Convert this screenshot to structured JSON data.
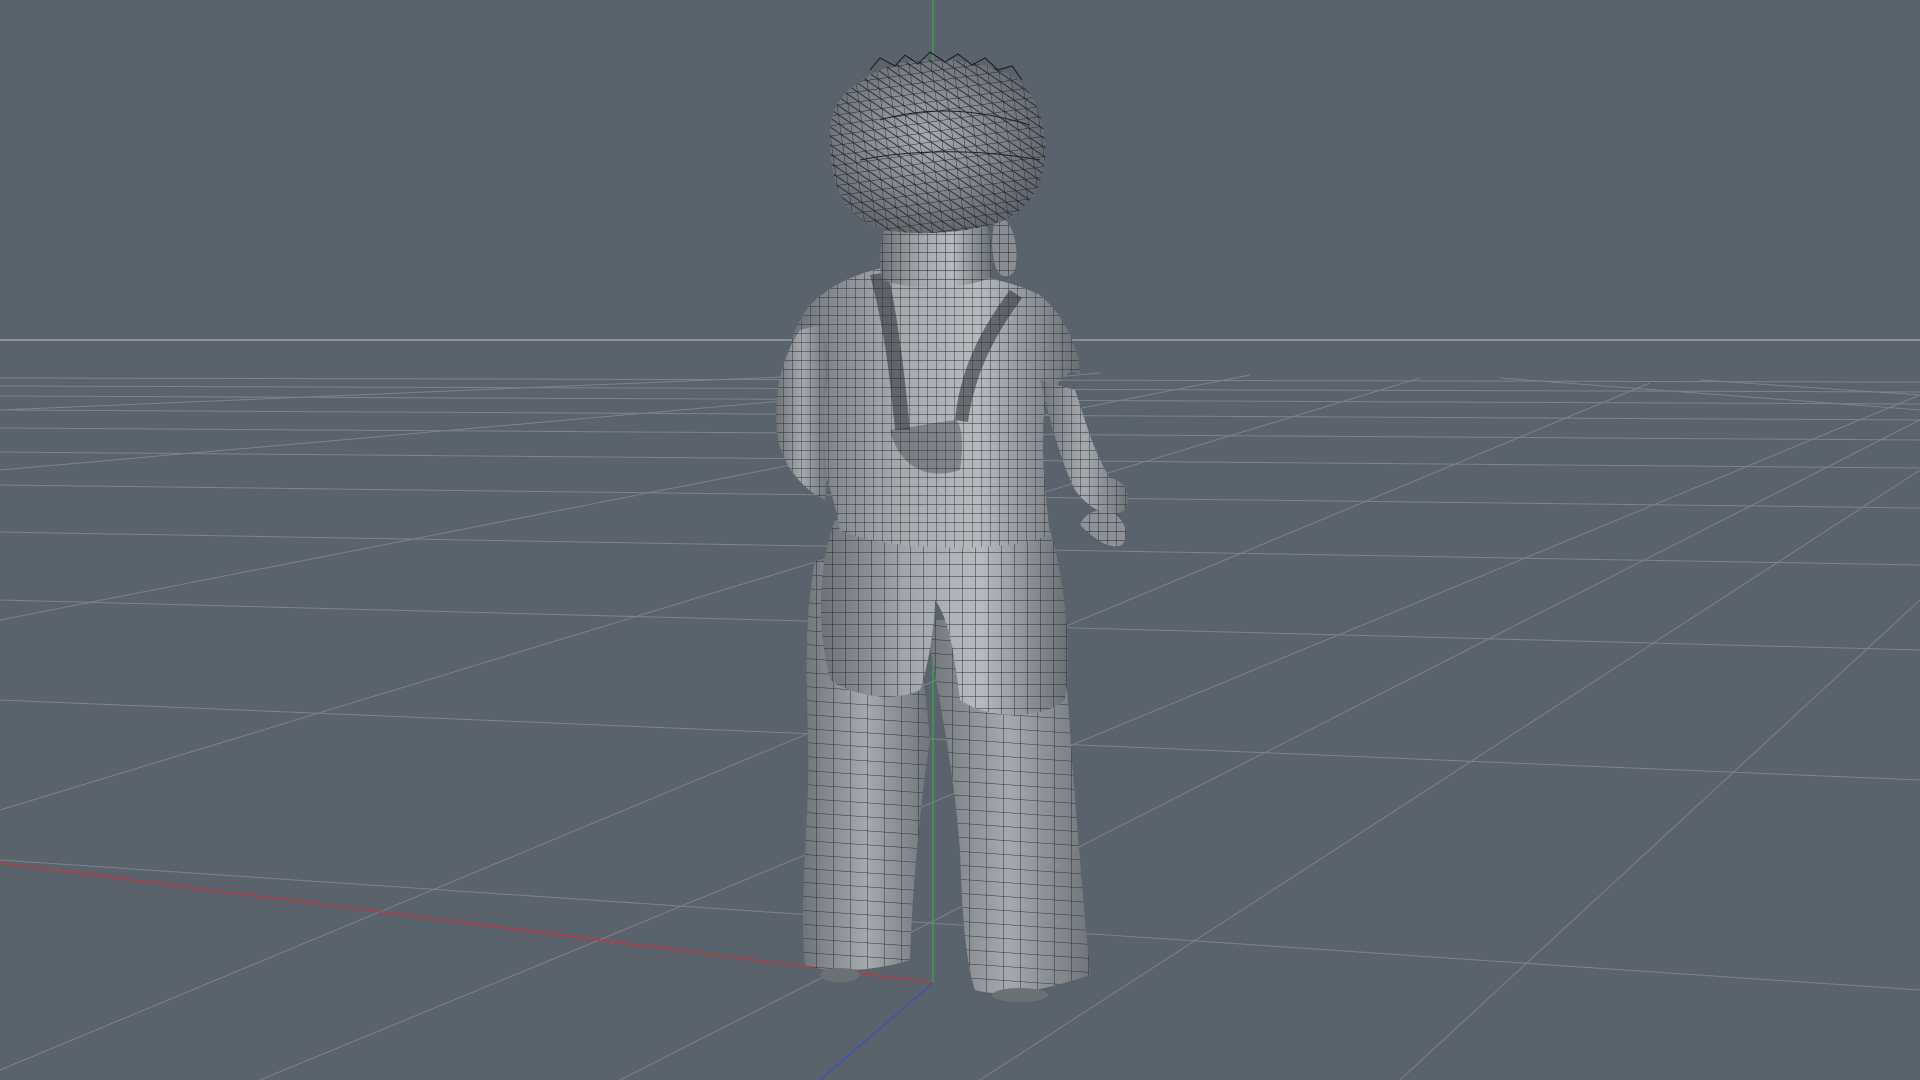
{
  "viewport": {
    "background_color": "#5a626b",
    "floor_grid_color": "#7c838b",
    "horizon_line_color": "#aab0b5",
    "axis_x_color": "#c0393b",
    "axis_y_color": "#3fa34a",
    "axis_z_color": "#3a52b8",
    "mesh_fill_color": "#8e9296",
    "mesh_shadow_color": "#6a6f74",
    "mesh_highlight_color": "#c4c8cc",
    "wireframe_color": "#202428",
    "display_mode": "shaded-with-wireframe",
    "view_from": "back",
    "model": "child-in-overalls"
  }
}
